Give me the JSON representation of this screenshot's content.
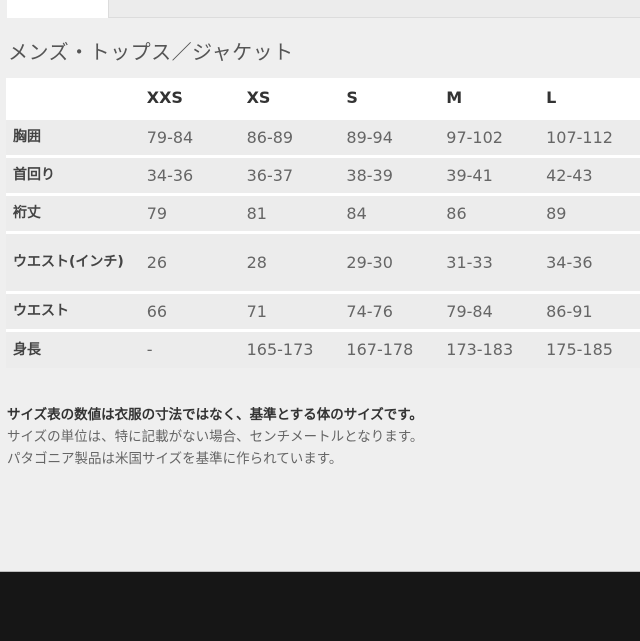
{
  "section_title": "メンズ・トップス／ジャケット",
  "table": {
    "columns": [
      "XXS",
      "XS",
      "S",
      "M",
      "L"
    ],
    "rows": [
      {
        "label": "胸囲",
        "values": [
          "79-84",
          "86-89",
          "89-94",
          "97-102",
          "107-112"
        ]
      },
      {
        "label": "首回り",
        "values": [
          "34-36",
          "36-37",
          "38-39",
          "39-41",
          "42-43"
        ]
      },
      {
        "label": "裄丈",
        "values": [
          "79",
          "81",
          "84",
          "86",
          "89"
        ]
      },
      {
        "label": "ウエスト(インチ)",
        "values": [
          "26",
          "28",
          "29-30",
          "31-33",
          "34-36"
        ]
      },
      {
        "label": "ウエスト",
        "values": [
          "66",
          "71",
          "74-76",
          "79-84",
          "86-91"
        ]
      },
      {
        "label": "身長",
        "values": [
          "-",
          "165-173",
          "167-178",
          "173-183",
          "175-185"
        ]
      }
    ]
  },
  "notes": [
    "サイズ表の数値は衣服の寸法ではなく、基準とする体のサイズです。",
    "サイズの単位は、特に記載がない場合、センチメートルとなります。",
    "パタゴニア製品は米国サイズを基準に作られています。"
  ]
}
